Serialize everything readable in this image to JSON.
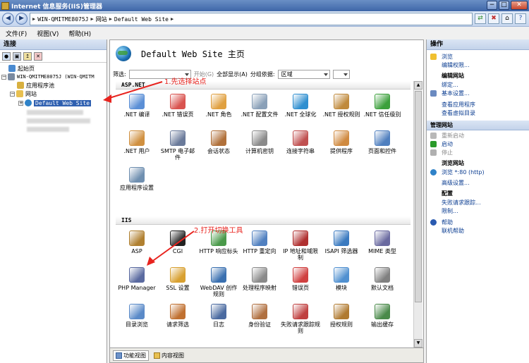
{
  "window": {
    "title": "Internet 信息服务(IIS)管理器",
    "min": "−",
    "max": "□",
    "close": "✕"
  },
  "address": {
    "back": "◀",
    "forward": "▶",
    "crumbs": [
      "WIN-QMITME8075J",
      "网站",
      "Default Web Site"
    ],
    "tb_icons": [
      "⇄",
      "✖",
      "⌂",
      "?"
    ]
  },
  "menu": [
    "文件(F)",
    "视图(V)",
    "帮助(H)"
  ],
  "left": {
    "header": "连接",
    "tree": {
      "start": "起始页",
      "server": "WIN-QMITME8075J (WIN-QMITM",
      "apppools": "应用程序池",
      "sites": "网站",
      "selected": "Default Web Site"
    }
  },
  "center": {
    "title": "Default Web Site 主页",
    "filter": {
      "label": "筛选:",
      "go": "开始(G)",
      "showall": "全部显示(A)",
      "groupby": "分组依据:",
      "group_value": "区域"
    },
    "sections": [
      "ASP.NET",
      "IIS"
    ],
    "aspnet_items": [
      {
        "label": ".NET 编译",
        "icon": "net-compilation-icon",
        "color": "#5b8fd6"
      },
      {
        "label": ".NET 错误页",
        "icon": "net-error-pages-icon",
        "color": "#d9534f"
      },
      {
        "label": ".NET 角色",
        "icon": "net-roles-icon",
        "color": "#e0a040"
      },
      {
        "label": ".NET 配置文件",
        "icon": "net-profile-icon",
        "color": "#8aa0b8"
      },
      {
        "label": ".NET 全球化",
        "icon": "net-globalization-icon",
        "color": "#2f8fd0"
      },
      {
        "label": ".NET 授权规则",
        "icon": "net-authorization-icon",
        "color": "#c08a3c"
      },
      {
        "label": ".NET 信任级别",
        "icon": "net-trust-level-icon",
        "color": "#3ca03c"
      },
      {
        "label": ".NET 用户",
        "icon": "net-users-icon",
        "color": "#d09040"
      },
      {
        "label": "SMTP 电子邮件",
        "icon": "smtp-email-icon",
        "color": "#6a7a9a"
      },
      {
        "label": "会话状态",
        "icon": "session-state-icon",
        "color": "#b0703a"
      },
      {
        "label": "计算机密钥",
        "icon": "machine-key-icon",
        "color": "#8a8a8a"
      },
      {
        "label": "连接字符串",
        "icon": "connection-strings-icon",
        "color": "#c05050"
      },
      {
        "label": "提供程序",
        "icon": "providers-icon",
        "color": "#d08a40"
      },
      {
        "label": "页面和控件",
        "icon": "pages-controls-icon",
        "color": "#4f7fbf"
      },
      {
        "label": "应用程序设置",
        "icon": "app-settings-icon",
        "color": "#6f8fb0"
      }
    ],
    "iis_items": [
      {
        "label": "ASP",
        "icon": "asp-icon",
        "color": "#b08030"
      },
      {
        "label": "CGI",
        "icon": "cgi-icon",
        "color": "#222222"
      },
      {
        "label": "HTTP 响应标头",
        "icon": "http-headers-icon",
        "color": "#4a9a4a"
      },
      {
        "label": "HTTP 重定向",
        "icon": "http-redirect-icon",
        "color": "#5080c0"
      },
      {
        "label": "IP 地址和域限制",
        "icon": "ip-restrictions-icon",
        "color": "#b03030"
      },
      {
        "label": "ISAPI 筛选器",
        "icon": "isapi-filters-icon",
        "color": "#3a7ac0"
      },
      {
        "label": "MIME 类型",
        "icon": "mime-types-icon",
        "color": "#6a6aa0"
      },
      {
        "label": "PHP Manager",
        "icon": "php-manager-icon",
        "color": "#5a6aa0"
      },
      {
        "label": "SSL 设置",
        "icon": "ssl-settings-icon",
        "color": "#d8a030"
      },
      {
        "label": "WebDAV 创作规则",
        "icon": "webdav-icon",
        "color": "#3a70b0"
      },
      {
        "label": "处理程序映射",
        "icon": "handler-mappings-icon",
        "color": "#8a8a8a"
      },
      {
        "label": "错误页",
        "icon": "error-pages-icon",
        "color": "#d04040"
      },
      {
        "label": "模块",
        "icon": "modules-icon",
        "color": "#5090d0"
      },
      {
        "label": "默认文档",
        "icon": "default-document-icon",
        "color": "#808080"
      },
      {
        "label": "目录浏览",
        "icon": "directory-browsing-icon",
        "color": "#5a8ac8"
      },
      {
        "label": "请求筛选",
        "icon": "request-filtering-icon",
        "color": "#c07030"
      },
      {
        "label": "日志",
        "icon": "logging-icon",
        "color": "#4a6aa0"
      },
      {
        "label": "身份验证",
        "icon": "authentication-icon",
        "color": "#b07040"
      },
      {
        "label": "失败请求跟踪规则",
        "icon": "failed-request-tracing-icon",
        "color": "#c04040"
      },
      {
        "label": "授权规则",
        "icon": "authorization-rules-icon",
        "color": "#b07a30"
      },
      {
        "label": "输出缓存",
        "icon": "output-caching-icon",
        "color": "#4a8a4a"
      }
    ],
    "views": {
      "features": "功能视图",
      "content": "内容视图"
    },
    "annotations": {
      "a1": "1.先选择站点",
      "a2": "2.打开切换工具"
    }
  },
  "right": {
    "header": "操作",
    "top_links": [
      "浏览",
      "编辑权限..."
    ],
    "edit_site": {
      "title": "编辑网站",
      "links": [
        "绑定...",
        "基本设置..."
      ],
      "more": [
        "查看应用程序",
        "查看虚拟目录"
      ]
    },
    "manage": {
      "title": "管理网站",
      "restart": "重新启动",
      "start": "启动",
      "stop": "停止"
    },
    "browse": {
      "title": "浏览网站",
      "link": "浏览 *:80 (http)",
      "advanced": "高级设置..."
    },
    "config": {
      "title": "配置",
      "links": [
        "失败请求跟踪...",
        "限制..."
      ]
    },
    "help": {
      "help": "帮助",
      "online": "联机帮助"
    },
    "accent": "#0b3d91"
  }
}
